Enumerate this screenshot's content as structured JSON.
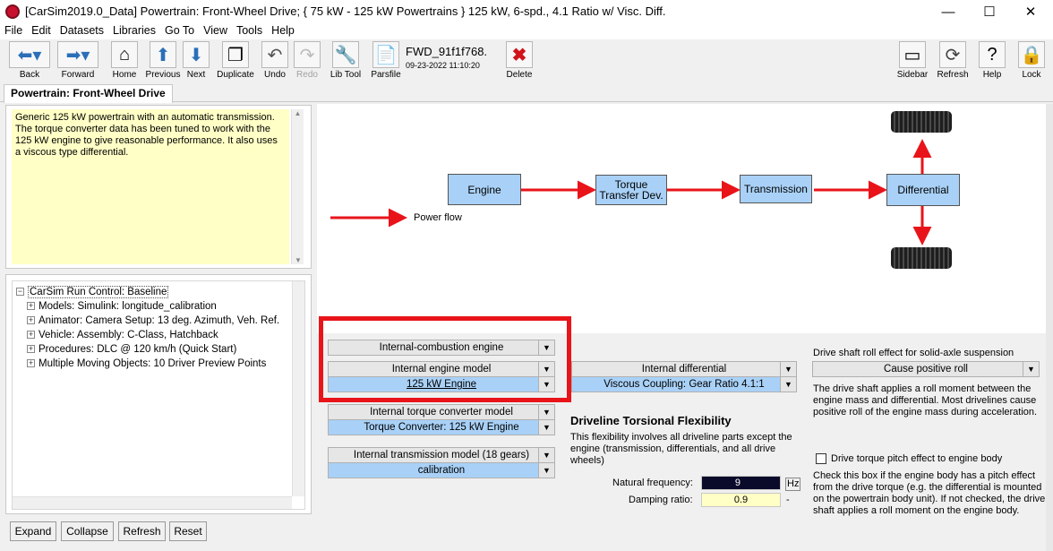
{
  "window": {
    "title": "[CarSim2019.0_Data] Powertrain: Front-Wheel Drive; { 75 kW - 125 kW Powertrains } 125 kW, 6-spd., 4.1 Ratio w/ Visc. Diff.",
    "minimize_glyph": "—",
    "maximize_glyph": "☐",
    "close_glyph": "✕"
  },
  "menu": {
    "file": "File",
    "edit": "Edit",
    "datasets": "Datasets",
    "libraries": "Libraries",
    "goto": "Go To",
    "view": "View",
    "tools": "Tools",
    "help": "Help"
  },
  "toolbar": {
    "back": "Back",
    "forward": "Forward",
    "home": "Home",
    "previous": "Previous",
    "next": "Next",
    "duplicate": "Duplicate",
    "undo": "Undo",
    "redo": "Redo",
    "lib_tool": "Lib Tool",
    "parsfile": "Parsfile",
    "file_id": "FWD_91f1f768.",
    "file_date": "09-23-2022 11:10:20",
    "delete": "Delete",
    "sidebar": "Sidebar",
    "refresh": "Refresh",
    "help": "Help",
    "lock": "Lock"
  },
  "tab": {
    "label": "Powertrain: Front-Wheel Drive"
  },
  "notes": {
    "text": "Generic 125 kW powertrain with an automatic transmission. The torque converter data has been tuned to work with the 125 kW engine to give reasonable performance.  It also uses a viscous type differential."
  },
  "tree": {
    "root": "CarSim Run Control: Baseline",
    "items": [
      "Models: Simulink: longitude_calibration",
      "Animator: Camera Setup: 13 deg. Azimuth, Veh. Ref.",
      "Vehicle: Assembly: C-Class, Hatchback",
      "Procedures: DLC @ 120 km/h (Quick Start)",
      "Multiple Moving Objects: 10 Driver Preview Points"
    ]
  },
  "tree_buttons": {
    "expand": "Expand",
    "collapse": "Collapse",
    "refresh": "Refresh",
    "reset": "Reset"
  },
  "diagram": {
    "engine": "Engine",
    "torque_transfer": "Torque Transfer Dev.",
    "transmission": "Transmission",
    "differential": "Differential",
    "power_flow": "Power flow",
    "arrow_color": "#e8141a",
    "box_color": "#a9d1f7"
  },
  "settings": {
    "engine_type": "Internal-combustion engine",
    "engine_model_label": "Internal engine model",
    "engine_model_value": "125 kW Engine",
    "torque_converter_label": "Internal torque converter model",
    "torque_converter_value": "Torque Converter: 125 kW Engine",
    "transmission_label": "Internal transmission model (18 gears)",
    "transmission_value": "calibration",
    "differential_label": "Internal differential",
    "differential_value": "Viscous Coupling: Gear Ratio 4.1:1",
    "torsional_title": "Driveline Torsional Flexibility",
    "torsional_desc": "This flexibility involves all driveline parts except the engine (transmission, differentials, and all drive wheels)",
    "natural_freq_label": "Natural frequency:",
    "natural_freq_value": "9",
    "natural_freq_unit": "Hz",
    "damping_label": "Damping ratio:",
    "damping_value": "0.9",
    "damping_unit": "-",
    "roll_title": "Drive shaft roll effect for solid-axle suspension",
    "roll_value": "Cause positive roll",
    "roll_desc": "The drive shaft applies a roll moment between the engine mass and differential.  Most drivelines cause positive roll of the engine mass during acceleration.",
    "pitch_label": "Drive torque pitch effect to engine body",
    "pitch_checked": false,
    "pitch_desc": "Check this box if the engine body has a pitch effect from the drive torque (e.g. the differential is mounted on the powertrain body unit). If not checked, the drive shaft applies a roll moment on the engine body.",
    "highlight_color": "#e8141a"
  }
}
